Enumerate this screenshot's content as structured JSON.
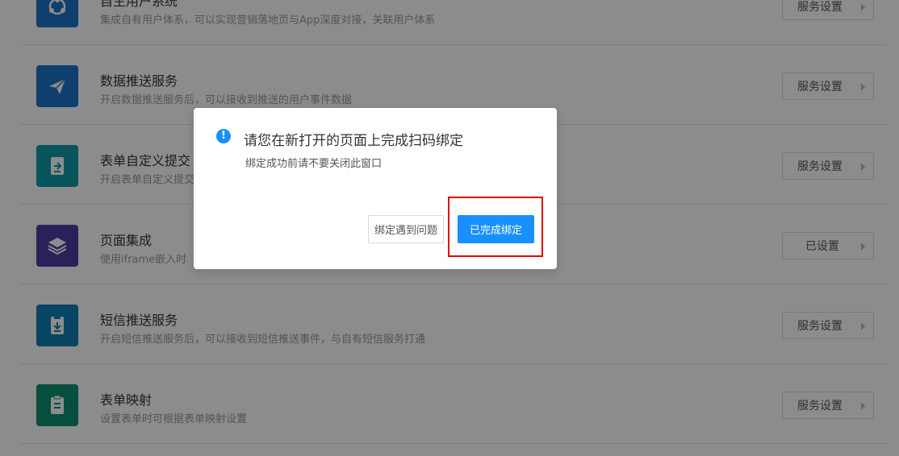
{
  "rows": [
    {
      "title": "自主用户系统",
      "desc": "集成自有用户体系，可以实现营销落地页与App深度对接，关联用户体系",
      "button": "服务设置",
      "icon": "users-icon",
      "color": "#1a73c8"
    },
    {
      "title": "数据推送服务",
      "desc": "开启数据推送服务后，可以接收到推送的用户事件数据",
      "button": "服务设置",
      "icon": "paper-plane-icon",
      "color": "#1a73c8"
    },
    {
      "title": "表单自定义提交",
      "desc": "开启表单自定义提交",
      "button": "服务设置",
      "icon": "form-submit-icon",
      "color": "#0e9aa7"
    },
    {
      "title": "页面集成",
      "desc": "使用iframe嵌入时",
      "button": "已设置",
      "icon": "layers-icon",
      "color": "#4b3fa3"
    },
    {
      "title": "短信推送服务",
      "desc": "开启短信推送服务后，可以接收到短信推送事件，与自有短信服务打通",
      "button": "服务设置",
      "icon": "sms-icon",
      "color": "#0e7fb5"
    },
    {
      "title": "表单映射",
      "desc": "设置表单时可根据表单映射设置",
      "button": "服务设置",
      "icon": "clipboard-icon",
      "color": "#0c8f6f"
    }
  ],
  "modal": {
    "title": "请您在新打开的页面上完成扫码绑定",
    "subtitle": "绑定成功前请不要关闭此窗口",
    "secondary_button": "绑定遇到问题",
    "primary_button": "已完成绑定",
    "accent": "#1890ff"
  },
  "highlight_color": "#e00000"
}
